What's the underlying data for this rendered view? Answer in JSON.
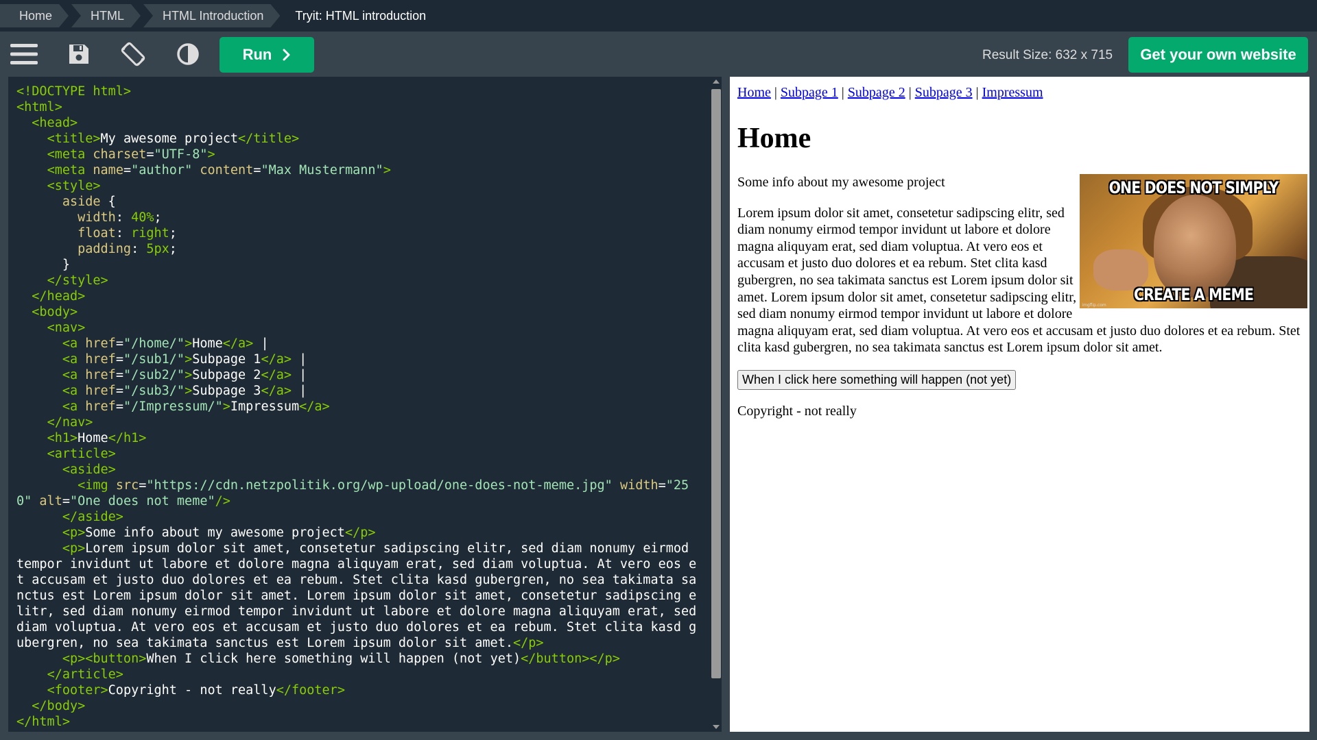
{
  "breadcrumb": [
    "Home",
    "HTML",
    "HTML Introduction",
    "Tryit: HTML introduction"
  ],
  "toolbar": {
    "run_label": "Run",
    "result_size": "Result Size: 632 x 715",
    "get_website_label": "Get your own website"
  },
  "icons": [
    "menu-icon",
    "save-icon",
    "rotate-icon",
    "contrast-icon",
    "chevron-right-icon"
  ],
  "colors": {
    "accent": "#04aa6d",
    "topbar": "#1d2a35",
    "toolbar": "#38444d",
    "editor_bg": "#1e2a35",
    "tag": "#88ce02",
    "attr_name": "#ddca7e",
    "attr_value": "#a2e5b5"
  },
  "code": {
    "doctype": "<!DOCTYPE html>",
    "title_text": "My awesome project",
    "charset": "\"UTF-8\"",
    "author_name": "\"author\"",
    "author_content": "\"Max Mustermann\"",
    "css_selector": "aside",
    "css_width": "40%",
    "css_float": "right",
    "css_padding": "5px",
    "nav_links": [
      {
        "href": "\"/home/\"",
        "text": "Home"
      },
      {
        "href": "\"/sub1/\"",
        "text": "Subpage 1"
      },
      {
        "href": "\"/sub2/\"",
        "text": "Subpage 2"
      },
      {
        "href": "\"/sub3/\"",
        "text": "Subpage 3"
      },
      {
        "href": "\"/Impressum/\"",
        "text": "Impressum"
      }
    ],
    "h1_text": "Home",
    "img_src": "\"https://cdn.netzpolitik.org/wp-upload/one-does-not-meme.jpg\"",
    "img_width": "\"250\"",
    "img_alt": "\"One does not meme\"",
    "p1": "Some info about my awesome project",
    "p2": "Lorem ipsum dolor sit amet, consetetur sadipscing elitr, sed diam nonumy eirmod tempor invidunt ut labore et dolore magna aliquyam erat, sed diam voluptua. At vero eos et accusam et justo duo dolores et ea rebum. Stet clita kasd gubergren, no sea takimata sanctus est Lorem ipsum dolor sit amet. Lorem ipsum dolor sit amet, consetetur sadipscing elitr, sed diam nonumy eirmod tempor invidunt ut labore et dolore magna aliquyam erat, sed diam voluptua. At vero eos et accusam et justo duo dolores et ea rebum. Stet clita kasd gubergren, no sea takimata sanctus est Lorem ipsum dolor sit amet.",
    "button_text": "When I click here something will happen (not yet)",
    "footer_text": "Copyright - not really"
  },
  "result": {
    "nav": [
      "Home",
      "Subpage 1",
      "Subpage 2",
      "Subpage 3",
      "Impressum"
    ],
    "h1": "Home",
    "meme_top": "ONE DOES NOT SIMPLY",
    "meme_bottom": "CREATE A MEME",
    "meme_watermark": "imgflip.com",
    "p1": "Some info about my awesome project",
    "p2": "Lorem ipsum dolor sit amet, consetetur sadipscing elitr, sed diam nonumy eirmod tempor invidunt ut labore et dolore magna aliquyam erat, sed diam voluptua. At vero eos et accusam et justo duo dolores et ea rebum. Stet clita kasd gubergren, no sea takimata sanctus est Lorem ipsum dolor sit amet. Lorem ipsum dolor sit amet, consetetur sadipscing elitr, sed diam nonumy eirmod tempor invidunt ut labore et dolore magna aliquyam erat, sed diam voluptua. At vero eos et accusam et justo duo dolores et ea rebum. Stet clita kasd gubergren, no sea takimata sanctus est Lorem ipsum dolor sit amet.",
    "button": "When I click here something will happen (not yet)",
    "footer": "Copyright - not really"
  }
}
